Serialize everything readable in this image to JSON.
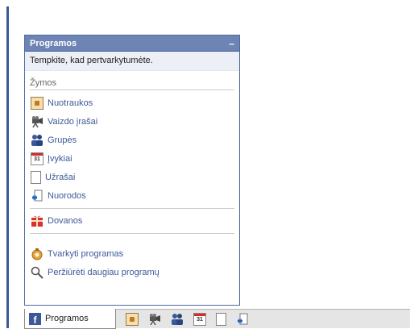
{
  "panel": {
    "title": "Programos",
    "collapse_label": "–",
    "hint": "Tempkite, kad pertvarkytumėte.",
    "section_label": "Žymos",
    "bookmarks": [
      {
        "label": "Nuotraukos",
        "icon": "photos-icon"
      },
      {
        "label": "Vaizdo įrašai",
        "icon": "video-icon"
      },
      {
        "label": "Grupės",
        "icon": "groups-icon"
      },
      {
        "label": "Įvykiai",
        "icon": "events-icon"
      },
      {
        "label": "Užrašai",
        "icon": "notes-icon"
      },
      {
        "label": "Nuorodos",
        "icon": "links-icon"
      }
    ],
    "gifts": {
      "label": "Dovanos",
      "icon": "gift-icon"
    },
    "manage": {
      "label": "Tvarkyti programas",
      "icon": "manage-apps-icon"
    },
    "browse": {
      "label": "Peržiūrėti daugiau programų",
      "icon": "search-icon"
    }
  },
  "toolbar": {
    "apps_label": "Programos",
    "logo_letter": "f",
    "calendar_day": "31"
  },
  "colors": {
    "brand": "#3b5998",
    "header": "#6d84b4",
    "link": "#3b5998"
  }
}
